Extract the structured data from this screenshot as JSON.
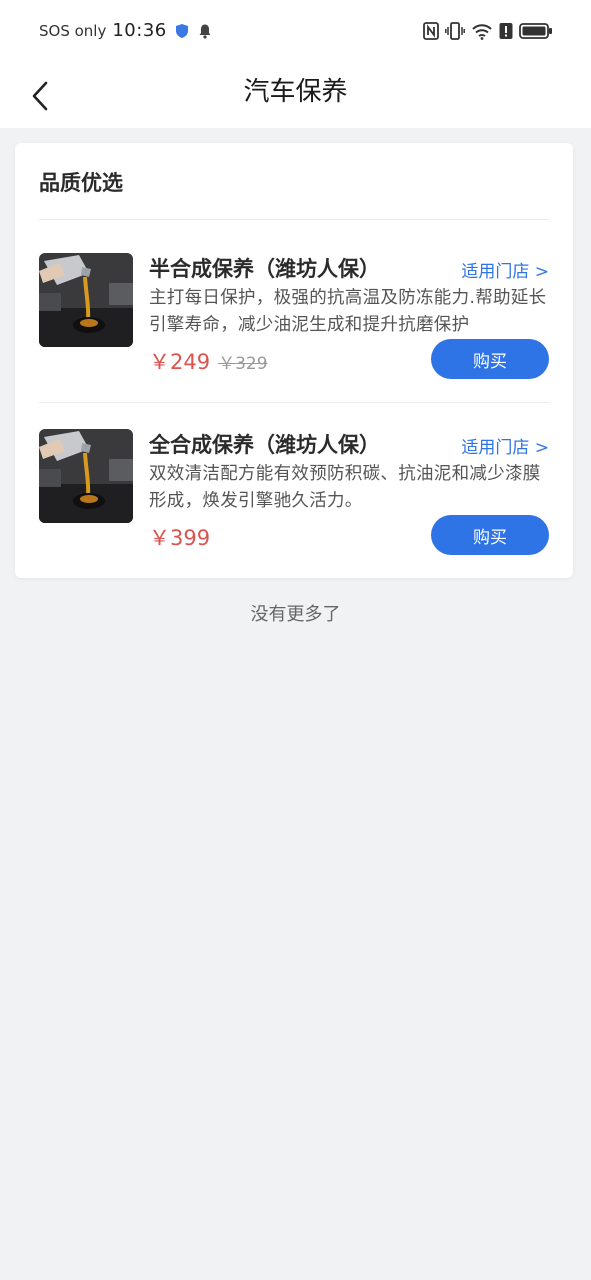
{
  "status_bar": {
    "sos": "SOS only",
    "time": "10:36",
    "icons": [
      "shield-icon",
      "bell-icon",
      "nfc-icon",
      "vibrate-icon",
      "wifi-icon",
      "alert-icon",
      "battery-icon"
    ]
  },
  "header": {
    "title": "汽车保养",
    "back_icon": "chevron-left-icon"
  },
  "section": {
    "title": "品质优选",
    "items": [
      {
        "name": "半合成保养（潍坊人保）",
        "store_link": "适用门店 >",
        "description": "主打每日保护，极强的抗高温及防冻能力.帮助延长引擎寿命，减少油泥生成和提升抗磨保护",
        "price": "￥249",
        "original_price": "￥329",
        "buy_label": "购买",
        "image": "oil-pouring-photo"
      },
      {
        "name": "全合成保养（潍坊人保）",
        "store_link": "适用门店 >",
        "description": "双效清洁配方能有效预防积碳、抗油泥和减少漆膜形成，焕发引擎驰久活力。",
        "price": "￥399",
        "original_price": "",
        "buy_label": "购买",
        "image": "oil-pouring-photo"
      }
    ]
  },
  "footer": {
    "note": "没有更多了"
  },
  "colors": {
    "accent": "#2f74e6",
    "price": "#d9534f",
    "background": "#f1f2f4"
  }
}
